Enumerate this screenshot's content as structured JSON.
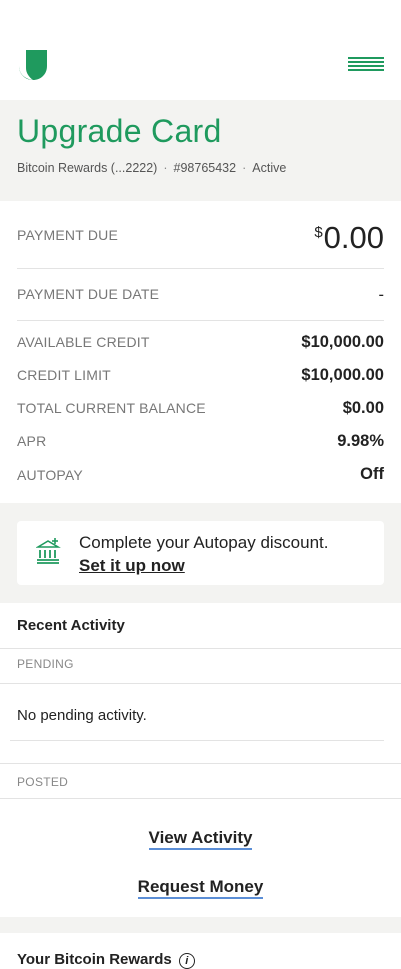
{
  "header": {},
  "card": {
    "title": "Upgrade Card",
    "product": "Bitcoin Rewards (...2222)",
    "account_number": "#98765432",
    "status": "Active"
  },
  "summary": {
    "payment_due_label": "PAYMENT DUE",
    "payment_due_currency": "$",
    "payment_due_value": "0.00",
    "payment_due_date_label": "PAYMENT DUE DATE",
    "payment_due_date_value": "-",
    "rows": [
      {
        "label": "AVAILABLE CREDIT",
        "value": "$10,000.00"
      },
      {
        "label": "CREDIT LIMIT",
        "value": "$10,000.00"
      },
      {
        "label": "TOTAL CURRENT BALANCE",
        "value": "$0.00"
      },
      {
        "label": "APR",
        "value": "9.98%"
      },
      {
        "label": "AUTOPAY",
        "value": "Off"
      }
    ]
  },
  "promo": {
    "text": "Complete your Autopay discount.",
    "link": "Set it up now"
  },
  "activity": {
    "title": "Recent Activity",
    "pending_label": "PENDING",
    "pending_empty": "No pending activity.",
    "posted_label": "POSTED",
    "view_activity": "View Activity",
    "request_money": "Request Money"
  },
  "rewards": {
    "title": "Your Bitcoin Rewards"
  },
  "colors": {
    "brand_green": "#1f9a5e",
    "band_gray": "#f3f3f1",
    "link_underline": "#5b8ed6"
  }
}
